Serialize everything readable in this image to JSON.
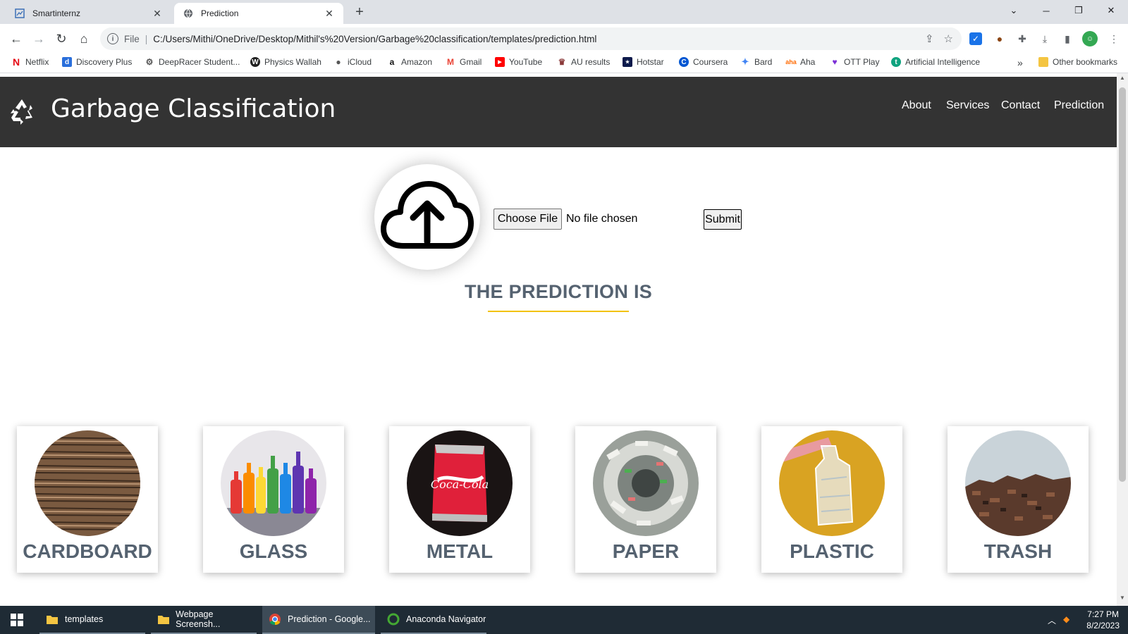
{
  "browser": {
    "tabs": [
      {
        "title": "Smartinternz",
        "active": false
      },
      {
        "title": "Prediction",
        "active": true
      }
    ],
    "address": {
      "scheme_label": "File",
      "url": "C:/Users/Mithi/OneDrive/Desktop/Mithil's%20Version/Garbage%20classification/templates/prediction.html"
    },
    "bookmarks": [
      "Netflix",
      "Discovery Plus",
      "DeepRacer Student...",
      "Physics Wallah",
      "iCloud",
      "Amazon",
      "Gmail",
      "YouTube",
      "AU results",
      "Hotstar",
      "Coursera",
      "Bard",
      "Aha",
      "OTT Play",
      "Artificial Intelligence"
    ],
    "other_bookmarks": "Other bookmarks",
    "overflow": "»"
  },
  "site": {
    "title": "Garbage Classification",
    "nav": [
      "About",
      "Services",
      "Contact",
      "Prediction"
    ]
  },
  "upload": {
    "choose_file_label": "Choose File",
    "file_status": "No file chosen",
    "submit_label": "Submit"
  },
  "prediction": {
    "heading": "THE PREDICTION IS",
    "result": ""
  },
  "categories": [
    {
      "label": "CARDBOARD",
      "image_icon": "cardboard-image"
    },
    {
      "label": "GLASS",
      "image_icon": "glass-bottles-image"
    },
    {
      "label": "METAL",
      "image_icon": "metal-can-image"
    },
    {
      "label": "PAPER",
      "image_icon": "paper-image"
    },
    {
      "label": "PLASTIC",
      "image_icon": "plastic-bottle-image"
    },
    {
      "label": "TRASH",
      "image_icon": "trash-heap-image"
    }
  ],
  "taskbar": {
    "items": [
      "templates",
      "Webpage Screensh...",
      "Prediction - Google...",
      "Anaconda Navigator"
    ],
    "time": "7:27 PM",
    "date": "8/2/2023"
  },
  "colors": {
    "header_bg": "#333333",
    "accent_underline": "#f2c200",
    "heading_text": "#556270",
    "taskbar_bg": "#1f2b35"
  }
}
